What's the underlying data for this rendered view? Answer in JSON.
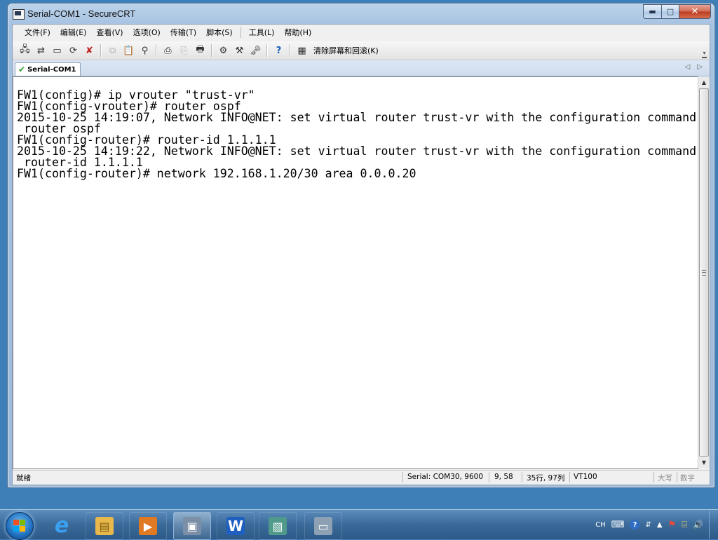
{
  "window": {
    "title": "Serial-COM1 - SecureCRT",
    "minimize_glyph": "▬",
    "maximize_glyph": "□",
    "close_glyph": "✕"
  },
  "menubar": {
    "items": [
      "文件(F)",
      "编辑(E)",
      "查看(V)",
      "选项(O)",
      "传输(T)",
      "脚本(S)",
      "工具(L)",
      "帮助(H)"
    ]
  },
  "toolbar": {
    "clear_label": "清除屏幕和回滚(K)",
    "grip_glyph": "▾",
    "icons": {
      "connect": "🖧",
      "quick_connect": "⇄",
      "connect_tab": "▭",
      "reconnect": "⟳",
      "disconnect": "✘",
      "copy": "⧉",
      "paste": "📋",
      "find": "⚲",
      "print_screen": "⎙",
      "print_selection": "⎘",
      "print": "🖶",
      "session_options": "⚙",
      "global_options": "⚒",
      "keymap": "🗝",
      "help": "?",
      "clear_screen": "▦"
    }
  },
  "tabs": {
    "active": "Serial-COM1",
    "check_glyph": "✔",
    "prev_glyph": "◁",
    "next_glyph": "▷"
  },
  "terminal": {
    "text": "FW1(config)# ip vrouter \"trust-vr\"\nFW1(config-vrouter)# router ospf\n2015-10-25 14:19:07, Network INFO@NET: set virtual router trust-vr with the configuration command\n router ospf\nFW1(config-router)# router-id 1.1.1.1\n2015-10-25 14:19:22, Network INFO@NET: set virtual router trust-vr with the configuration command\n router-id 1.1.1.1\nFW1(config-router)# network 192.168.1.20/30 area 0.0.0.20"
  },
  "scrollbar": {
    "up_glyph": "▲",
    "down_glyph": "▼"
  },
  "statusbar": {
    "ready": "就绪",
    "serial": "Serial: COM30, 9600",
    "cursor": "9,  58",
    "size": "35行, 97列",
    "emulation": "VT100",
    "caps": "大写",
    "num": "数字"
  },
  "taskbar": {
    "apps": [
      {
        "name": "internet-explorer",
        "glyph": "e",
        "color": "#1e88d8"
      },
      {
        "name": "file-explorer",
        "glyph": "▤",
        "color": "#e8b84a"
      },
      {
        "name": "media-player",
        "glyph": "▶",
        "color": "#e07a22"
      },
      {
        "name": "securecrt",
        "glyph": "▣",
        "color": "#7b8fa6"
      },
      {
        "name": "wps-writer",
        "glyph": "W",
        "color": "#1e5fc0"
      },
      {
        "name": "picture-viewer",
        "glyph": "▧",
        "color": "#4f9a8a"
      },
      {
        "name": "terminal-window",
        "glyph": "▭",
        "color": "#8ea0b4"
      }
    ],
    "tray": {
      "language": "CH",
      "keyboard_glyph": "⌨",
      "help_glyph": "?",
      "ime_glyph": "⇵",
      "show_hidden_glyph": "▲",
      "action_center_glyph": "⚑",
      "network_glyph": "⌸",
      "volume_glyph": "🔊"
    }
  }
}
